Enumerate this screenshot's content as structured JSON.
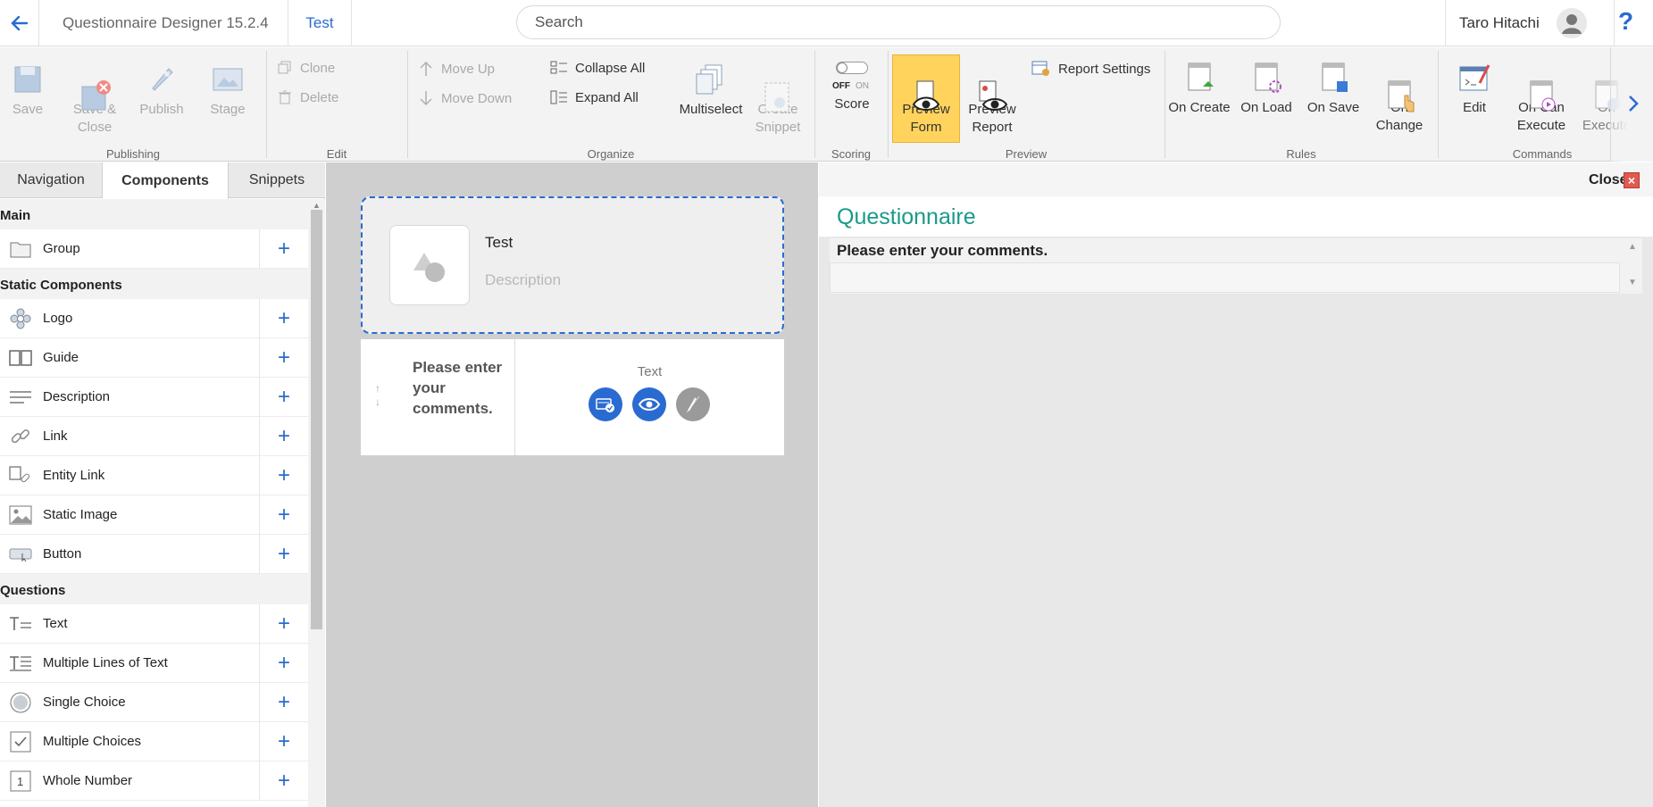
{
  "app": {
    "title": "Questionnaire Designer 15.2.4",
    "doc_tab": "Test",
    "search_placeholder": "Search",
    "user_name": "Taro Hitachi",
    "help": "?"
  },
  "ribbon": {
    "publishing": {
      "save": "Save",
      "save_close": "Save &\nClose",
      "publish": "Publish",
      "stage": "Stage",
      "label": "Publishing"
    },
    "edit": {
      "clone": "Clone",
      "delete": "Delete",
      "label": "Edit"
    },
    "organize": {
      "move_up": "Move Up",
      "move_down": "Move Down",
      "collapse_all": "Collapse All",
      "expand_all": "Expand All",
      "multiselect": "Multiselect",
      "create_snippet": "Create\nSnippet",
      "label": "Organize"
    },
    "scoring": {
      "toggle_off": "OFF",
      "toggle_on": "ON",
      "score": "Score",
      "label": "Scoring"
    },
    "preview": {
      "preview_form": "Preview\nForm",
      "preview_report": "Preview\nReport",
      "report_settings": "Report Settings",
      "label": "Preview"
    },
    "rules": {
      "on_create": "On Create",
      "on_load": "On Load",
      "on_save": "On Save",
      "on_change": "On\nChange",
      "label": "Rules"
    },
    "commands": {
      "edit": "Edit",
      "on_can_execute": "On Can\nExecute",
      "on_execute": "On\nExecute",
      "label": "Commands"
    }
  },
  "left_panel": {
    "tabs": [
      "Navigation",
      "Components",
      "Snippets"
    ],
    "active_tab": "Components",
    "sections": [
      {
        "title": "Main",
        "items": [
          {
            "label": "Group",
            "icon": "folder-icon"
          }
        ]
      },
      {
        "title": "Static Components",
        "items": [
          {
            "label": "Logo",
            "icon": "flower-icon"
          },
          {
            "label": "Guide",
            "icon": "book-icon"
          },
          {
            "label": "Description",
            "icon": "lines-icon"
          },
          {
            "label": "Link",
            "icon": "chain-link-icon"
          },
          {
            "label": "Entity Link",
            "icon": "entity-link-icon"
          },
          {
            "label": "Static Image",
            "icon": "image-icon"
          },
          {
            "label": "Button",
            "icon": "button-icon"
          }
        ]
      },
      {
        "title": "Questions",
        "items": [
          {
            "label": "Text",
            "icon": "text-icon"
          },
          {
            "label": "Multiple Lines of Text",
            "icon": "multiline-text-icon"
          },
          {
            "label": "Single Choice",
            "icon": "radio-icon"
          },
          {
            "label": "Multiple Choices",
            "icon": "checkbox-icon"
          },
          {
            "label": "Whole Number",
            "icon": "number-icon"
          }
        ]
      }
    ]
  },
  "canvas": {
    "header_title": "Test",
    "header_description": "Description",
    "question_text": "Please enter your comments.",
    "question_type": "Text"
  },
  "preview": {
    "close_label": "Close",
    "title": "Questionnaire",
    "question_label": "Please enter your comments."
  },
  "colors": {
    "accent": "#2a6bd1",
    "active_button": "#ffd35c",
    "preview_title": "#1a9a8a"
  }
}
